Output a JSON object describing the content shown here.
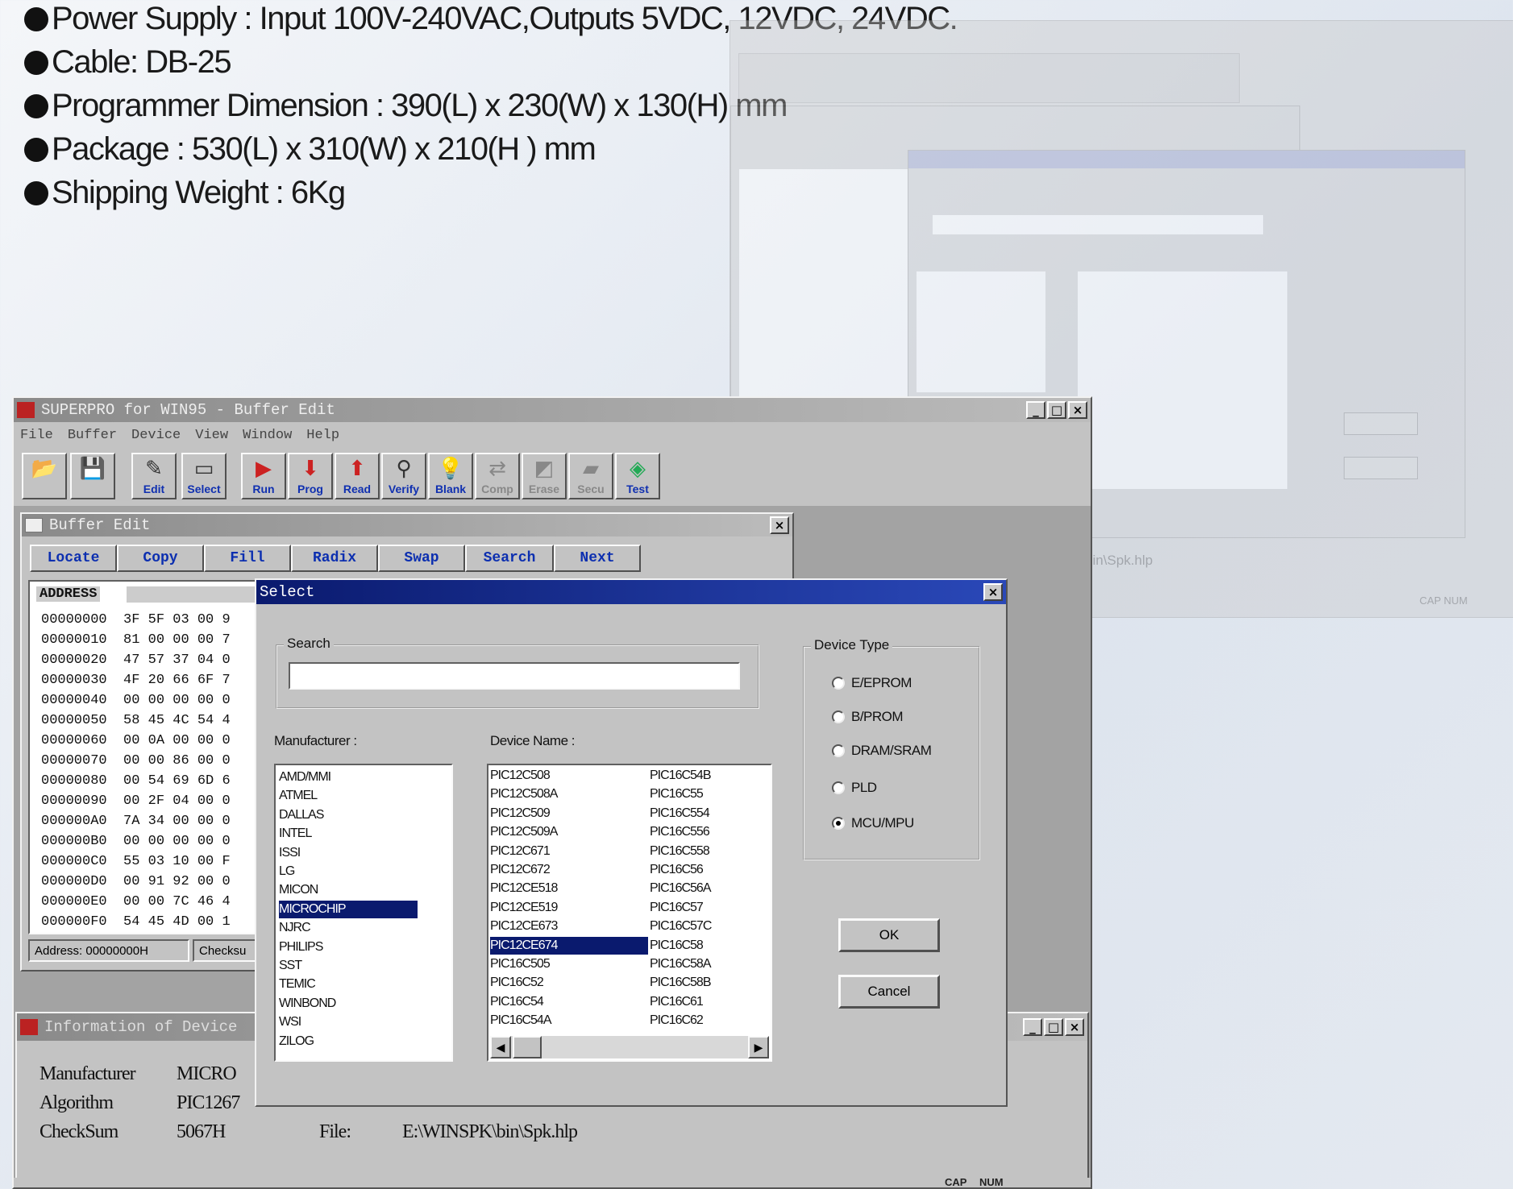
{
  "specs": [
    "Power Supply : Input 100V-240VAC,Outputs 5VDC, 12VDC, 24VDC.",
    "Cable: DB-25",
    "Programmer Dimension : 390(L) x 230(W) x 130(H) mm",
    "Package : 530(L) x 310(W) x 210(H ) mm",
    "Shipping Weight : 6Kg"
  ],
  "main_window": {
    "title": "SUPERPRO for WIN95 - Buffer Edit",
    "menu": [
      "File",
      "Buffer",
      "Device",
      "View",
      "Window",
      "Help"
    ],
    "toolbar": [
      {
        "label": "",
        "icon": "open-folder-icon",
        "glyph": "📂"
      },
      {
        "label": "",
        "icon": "save-disk-icon",
        "glyph": "💾"
      },
      {
        "label": "Edit",
        "icon": "edit-icon",
        "glyph": "✎"
      },
      {
        "label": "Select",
        "icon": "chip-icon",
        "glyph": "▭"
      },
      {
        "label": "Run",
        "icon": "run-icon",
        "glyph": "▶"
      },
      {
        "label": "Prog",
        "icon": "program-icon",
        "glyph": "⬇"
      },
      {
        "label": "Read",
        "icon": "read-icon",
        "glyph": "⬆"
      },
      {
        "label": "Verify",
        "icon": "verify-icon",
        "glyph": "⚲"
      },
      {
        "label": "Blank",
        "icon": "bulb-icon",
        "glyph": "💡"
      },
      {
        "label": "Comp",
        "icon": "compare-icon",
        "glyph": "⇄"
      },
      {
        "label": "Erase",
        "icon": "erase-icon",
        "glyph": "◩"
      },
      {
        "label": "Secu",
        "icon": "security-icon",
        "glyph": "▰"
      },
      {
        "label": "Test",
        "icon": "test-icon",
        "glyph": "◈"
      }
    ],
    "status": [
      "CAP",
      "NUM"
    ]
  },
  "buffer_edit": {
    "title": "Buffer Edit",
    "buttons": [
      "Locate",
      "Copy",
      "Fill",
      "Radix",
      "Swap",
      "Search",
      "Next"
    ],
    "address_header": "ADDRESS",
    "rows": [
      [
        "00000000",
        "3F 5F 03 00 9"
      ],
      [
        "00000010",
        "81 00 00 00 7"
      ],
      [
        "00000020",
        "47 57 37 04 0"
      ],
      [
        "00000030",
        "4F 20 66 6F 7"
      ],
      [
        "00000040",
        "00 00 00 00 0"
      ],
      [
        "00000050",
        "58 45 4C 54 4"
      ],
      [
        "00000060",
        "00 0A 00 00 0"
      ],
      [
        "00000070",
        "00 00 86 00 0"
      ],
      [
        "00000080",
        "00 54 69 6D 6"
      ],
      [
        "00000090",
        "00 2F 04 00 0"
      ],
      [
        "000000A0",
        "7A 34 00 00 0"
      ],
      [
        "000000B0",
        "00 00 00 00 0"
      ],
      [
        "000000C0",
        "55 03 10 00 F"
      ],
      [
        "000000D0",
        "00 91 92 00 0"
      ],
      [
        "000000E0",
        "00 00 7C 46 4"
      ],
      [
        "000000F0",
        "54 45 4D 00 1"
      ]
    ],
    "status_address": "Address: 00000000H",
    "status_checksum": "Checksu"
  },
  "select_dialog": {
    "title": "Select",
    "search_label": "Search",
    "search_value": "",
    "manufacturer_label": "Manufacturer :",
    "manufacturers": [
      "AMD/MMI",
      "ATMEL",
      "DALLAS",
      "INTEL",
      "ISSI",
      "LG",
      "MICON",
      "MICROCHIP",
      "NJRC",
      "PHILIPS",
      "SST",
      "TEMIC",
      "WINBOND",
      "WSI",
      "ZILOG"
    ],
    "selected_manufacturer": "MICROCHIP",
    "device_label": "Device Name :",
    "devices_col1": [
      "PIC12C508",
      "PIC12C508A",
      "PIC12C509",
      "PIC12C509A",
      "PIC12C671",
      "PIC12C672",
      "PIC12CE518",
      "PIC12CE519",
      "PIC12CE673",
      "PIC12CE674",
      "PIC16C505",
      "PIC16C52",
      "PIC16C54",
      "PIC16C54A"
    ],
    "devices_col2": [
      "PIC16C54B",
      "PIC16C55",
      "PIC16C554",
      "PIC16C556",
      "PIC16C558",
      "PIC16C56",
      "PIC16C56A",
      "PIC16C57",
      "PIC16C57C",
      "PIC16C58",
      "PIC16C58A",
      "PIC16C58B",
      "PIC16C61",
      "PIC16C62"
    ],
    "selected_device": "PIC12CE674",
    "device_type_label": "Device Type",
    "device_types": [
      "E/EPROM",
      "B/PROM",
      "DRAM/SRAM",
      "PLD",
      "MCU/MPU"
    ],
    "selected_type": "MCU/MPU",
    "ok_label": "OK",
    "cancel_label": "Cancel"
  },
  "info_window": {
    "title": "Information of Device",
    "manufacturer_label": "Manufacturer",
    "manufacturer_value": "MICRO",
    "algorithm_label": "Algorithm",
    "algorithm_value": "PIC1267",
    "checksum_label": "CheckSum",
    "checksum_value": "5067H",
    "file_label": "File:",
    "file_value": "E:\\WINSPK\\bin\\Spk.hlp"
  },
  "bg_window": {
    "file_fragment": "bin\\Spk.hlp",
    "status": "CAP NUM"
  }
}
